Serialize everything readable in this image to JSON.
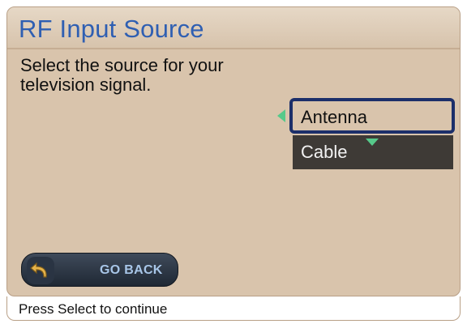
{
  "window": {
    "title": "RF Input Source"
  },
  "main": {
    "instruction": "Select the source for your television signal."
  },
  "options": {
    "items": [
      {
        "label": "Antenna",
        "selected": true
      },
      {
        "label": "Cable",
        "selected": false
      }
    ]
  },
  "footer_button": {
    "label": "GO BACK",
    "icon": "back-arrow-icon"
  },
  "status_bar": {
    "text": "Press Select to continue"
  },
  "colors": {
    "panel_bg": "#d9c4ac",
    "title_text": "#2f5fb2",
    "selection_border": "#1c2f6a",
    "option_dark_bg": "#3e3a36",
    "arrow_accent": "#56c98a",
    "button_bg": "#1f2834",
    "button_text": "#a8c6e8",
    "back_icon": "#e6b34a"
  }
}
